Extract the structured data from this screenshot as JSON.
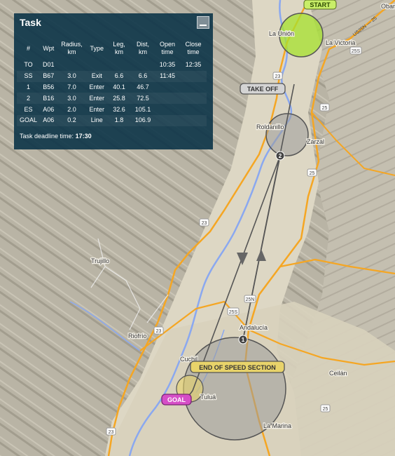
{
  "panel": {
    "title": "Task",
    "columns": [
      "#",
      "Wpt",
      "Radius, km",
      "Type",
      "Leg, km",
      "Dist, km",
      "Open time",
      "Close time"
    ],
    "rows": [
      [
        "TO",
        "D01",
        "",
        "",
        "",
        "",
        "10:35",
        "12:35"
      ],
      [
        "SS",
        "B67",
        "3.0",
        "Exit",
        "6.6",
        "6.6",
        "11:45",
        ""
      ],
      [
        "1",
        "B56",
        "7.0",
        "Enter",
        "40.1",
        "46.7",
        "",
        ""
      ],
      [
        "2",
        "B16",
        "3.0",
        "Enter",
        "25.8",
        "72.5",
        "",
        ""
      ],
      [
        "ES",
        "A06",
        "2.0",
        "Enter",
        "32.6",
        "105.1",
        "",
        ""
      ],
      [
        "GOAL",
        "A06",
        "0.2",
        "Line",
        "1.8",
        "106.9",
        "",
        ""
      ]
    ],
    "deadline_label": "Task deadline time:",
    "deadline_value": "17:30"
  },
  "places": {
    "obando": "Obar",
    "la_union": "La Unión",
    "la_victoria": "La Victoria",
    "roldanillo": "Roldanillo",
    "zarzal": "Zarzal",
    "trujillo": "Trujillo",
    "riofrio": "Riofrío",
    "andalucia": "Andalucía",
    "cuchilla": "Cuchil",
    "tulua": "Tuluá",
    "ceilan": "Ceilán",
    "la_marina": "La Marina"
  },
  "highways": {
    "us25n": "US25N — 25",
    "h25s_a": "25S",
    "h23_a": "23",
    "h25_a": "25",
    "h25_b": "25",
    "h23_b": "23",
    "h25n": "25N",
    "h25s_b": "25S",
    "h23_c": "23",
    "h25_c": "25",
    "h23_d": "23"
  },
  "labels": {
    "start": "START",
    "takeoff": "TAKE OFF",
    "end_of_speed": "END OF SPEED SECTION",
    "goal": "GOAL",
    "tp1": "1",
    "tp2": "2"
  },
  "colors": {
    "start_tag": "#c8ee68",
    "takeoff_tag": "#d4d4d4",
    "ess_tag": "#e8d36a",
    "goal_tag": "#d64ec7",
    "cylinder_fill": "#9a9a9a",
    "start_cylinder": "#a6e22e",
    "river": "#8aa8f0",
    "highway": "#f5a623"
  }
}
